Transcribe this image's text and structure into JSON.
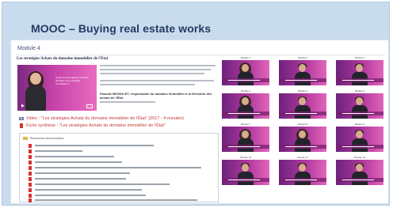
{
  "title": "MOOC – Buying real estate works",
  "module_label": "Module 4",
  "subheading": "Les stratégies Achats du domaine immobilier de l'État",
  "video": {
    "overlay_text": "Quels sont les apports d'achats durables de la stratégie immobilière ?"
  },
  "description": {
    "author": "Pascale MICHOLET, responsable du domaine Immobilier à la Direction des achats de l'État"
  },
  "links": [
    {
      "label": "Vidéo : \"Les stratégies Achats du domaine immobilier de l'État\" (2017 - 4 minutes)",
      "icon": "video-icon"
    },
    {
      "label": "Fiche synthèse : \"Les stratégies Achats du domaine immobilier de l'État\"",
      "icon": "pdf-icon"
    }
  ],
  "resources": {
    "heading": "Ressources documentaires",
    "count": 11
  },
  "modules": [
    {
      "label": "Module 1",
      "gender": "w"
    },
    {
      "label": "Module 2",
      "gender": "m"
    },
    {
      "label": "Module 3",
      "gender": "m"
    },
    {
      "label": "Module 4",
      "gender": "w"
    },
    {
      "label": "Module 5",
      "gender": "m"
    },
    {
      "label": "Module 6",
      "gender": "m"
    },
    {
      "label": "Module 7",
      "gender": "w"
    },
    {
      "label": "Module 8",
      "gender": "w"
    },
    {
      "label": "Module 9",
      "gender": "m"
    },
    {
      "label": "Module 10",
      "gender": "m"
    },
    {
      "label": "Module 11",
      "gender": "m"
    },
    {
      "label": "Module 12",
      "gender": "m"
    }
  ],
  "colors": {
    "accent_purple": "#b0379e",
    "link_red": "#c23a36",
    "title_navy": "#243a64",
    "frame_blue": "#c9dcee"
  }
}
